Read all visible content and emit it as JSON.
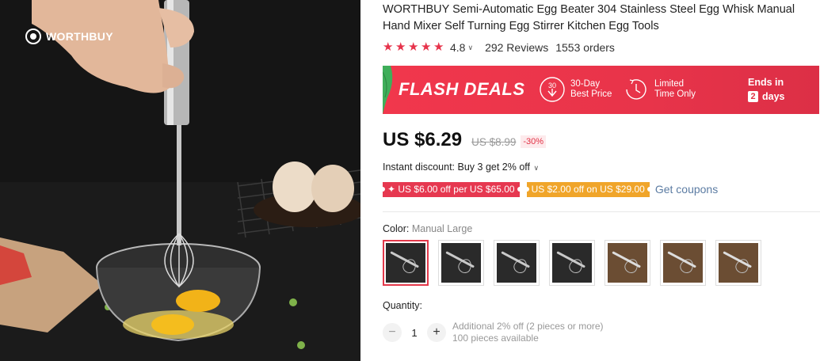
{
  "photo": {
    "brand": "WORTHBUY"
  },
  "product": {
    "title": "WORTHBUY Semi-Automatic Egg Beater 304 Stainless Steel Egg Whisk Manual Hand Mixer Self Turning Egg Stirrer Kitchen Egg Tools",
    "rating": "4.8",
    "reviews": "292 Reviews",
    "orders": "1553 orders"
  },
  "flash_deals": {
    "title": "FLASH DEALS",
    "feature_1_number": "30",
    "feature_1_line1": "30-Day",
    "feature_1_line2": "Best Price",
    "feature_2_line1": "Limited",
    "feature_2_line2": "Time Only",
    "ends_label": "Ends in",
    "days_number": "2",
    "days_unit": "days",
    "color": "#e8344a"
  },
  "price": {
    "current": "US $6.29",
    "original": "US $8.99",
    "discount": "-30%"
  },
  "promotions": {
    "instant_discount": "Instant discount: Buy 3 get 2% off",
    "coupon_1": "✦ US $6.00 off per US $65.00",
    "coupon_2": "US $2.00 off on US $29.00",
    "get_coupons": "Get coupons"
  },
  "variants": {
    "label": "Color:",
    "selected": "Manual Large",
    "swatch_count": 7,
    "selected_index": 0
  },
  "quantity": {
    "label": "Quantity:",
    "minus": "−",
    "value": "1",
    "plus": "+",
    "note_1": "Additional 2% off (2 pieces or more)",
    "note_2": "100 pieces available"
  }
}
